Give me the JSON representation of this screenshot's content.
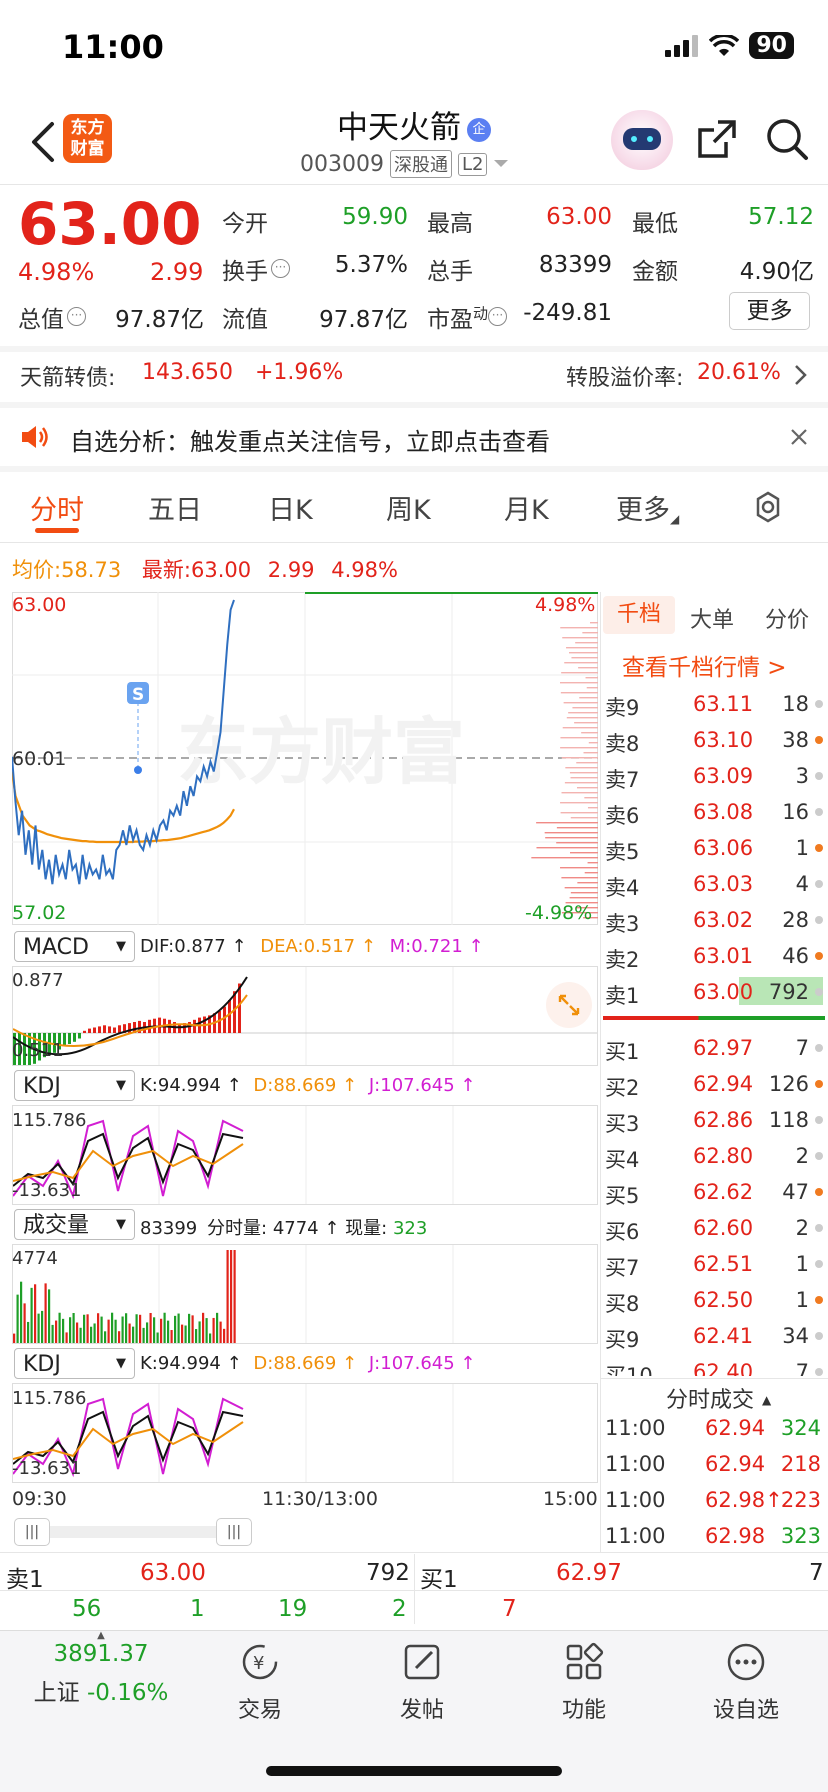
{
  "status_bar": {
    "time": "11:00",
    "battery": "90"
  },
  "header": {
    "name": "中天火箭",
    "badge": "企",
    "code": "003009",
    "tag1": "深股通",
    "tag2": "L2",
    "logo_line1": "东方",
    "logo_line2": "财富"
  },
  "quote": {
    "price": "63.00",
    "change_pct": "4.98%",
    "change": "2.99",
    "open_label": "今开",
    "open": "59.90",
    "high_label": "最高",
    "high": "63.00",
    "low_label": "最低",
    "low": "57.12",
    "turnover_label": "换手",
    "turnover": "5.37%",
    "volume_label": "总手",
    "volume": "83399",
    "amount_label": "金额",
    "amount": "4.90亿",
    "mktcap_label": "总值",
    "mktcap": "97.87亿",
    "float_label": "流值",
    "float": "97.87亿",
    "pe_label": "市盈",
    "pe_sup": "动",
    "pe": "-249.81",
    "more": "更多"
  },
  "bond": {
    "label": "天箭转债:",
    "price": "143.650",
    "change": "+1.96%",
    "premium_label": "转股溢价率:",
    "premium": "20.61%"
  },
  "notice": {
    "text": "自选分析：触发重点关注信号，立即点击查看"
  },
  "tabs": [
    "分时",
    "五日",
    "日K",
    "周K",
    "月K",
    "更多"
  ],
  "summary": {
    "avg_label": "均价:",
    "avg": "58.73",
    "last_label": "最新:",
    "last": "63.00",
    "chg": "2.99",
    "pct": "4.98%"
  },
  "chart_data": [
    {
      "type": "line",
      "x_start": "09:30",
      "x_mid": "11:30/13:00",
      "x_end": "15:00",
      "ylim": [
        57.02,
        63.0
      ],
      "y_top": "63.00",
      "y_mid": "60.01",
      "y_bottom": "57.02",
      "pct_top": "4.98%",
      "pct_bottom": "-4.98%",
      "watermark": "东方财富",
      "marker": "S",
      "series": [
        {
          "color": "#2f6fc0",
          "values": [
            59.8,
            58.9,
            58.2,
            58.7,
            57.8,
            58.3,
            57.6,
            58.4,
            57.5,
            57.9,
            57.3,
            57.7,
            57.2,
            57.8,
            57.4,
            57.6,
            57.3,
            57.9,
            57.5,
            57.6,
            57.2,
            57.8,
            57.3,
            57.6,
            57.4,
            57.5,
            57.3,
            57.8,
            57.4,
            57.5,
            57.3,
            57.9,
            58.0,
            58.3,
            58.0,
            58.4,
            58.1,
            58.3,
            58.0,
            57.9,
            58.2,
            58.0,
            58.3,
            58.1,
            58.4,
            58.5,
            58.3,
            58.7,
            58.6,
            58.8,
            58.6,
            59.1,
            58.8,
            59.2,
            59.0,
            59.4,
            59.3,
            59.6,
            59.4,
            59.7,
            59.5,
            59.9,
            60.3,
            61.2,
            62.1,
            62.8,
            63.0
          ]
        },
        {
          "color": "#f0900a",
          "values": [
            59.5,
            59.0,
            58.8,
            58.6,
            58.5,
            58.4,
            58.35,
            58.3,
            58.28,
            58.25,
            58.22,
            58.2,
            58.18,
            58.16,
            58.14,
            58.13,
            58.12,
            58.11,
            58.1,
            58.09,
            58.08,
            58.08,
            58.07,
            58.07,
            58.06,
            58.06,
            58.06,
            58.06,
            58.06,
            58.06,
            58.06,
            58.06,
            58.06,
            58.06,
            58.06,
            58.07,
            58.07,
            58.07,
            58.08,
            58.08,
            58.08,
            58.09,
            58.09,
            58.1,
            58.1,
            58.11,
            58.12,
            58.13,
            58.14,
            58.16,
            58.18,
            58.2,
            58.22,
            58.24,
            58.26,
            58.28,
            58.3,
            58.33,
            58.36,
            58.4,
            58.45,
            58.52,
            58.6,
            58.73
          ]
        }
      ]
    },
    {
      "type": "bar",
      "indicator": "MACD",
      "dif_label": "DIF:",
      "dif": "0.877",
      "dea_label": "DEA:",
      "dea": "0.517",
      "m_label": "M:",
      "m": "0.721",
      "y_top": "0.877",
      "y_bottom": "0.511",
      "histogram": [
        -0.3,
        -0.35,
        -0.32,
        -0.3,
        -0.28,
        -0.25,
        -0.22,
        -0.2,
        -0.18,
        -0.15,
        -0.12,
        -0.1,
        -0.08,
        -0.05,
        0.02,
        0.04,
        0.05,
        0.06,
        0.07,
        0.06,
        0.05,
        0.07,
        0.08,
        0.09,
        0.1,
        0.11,
        0.1,
        0.12,
        0.13,
        0.14,
        0.13,
        0.12,
        0.1,
        0.08,
        0.09,
        0.1,
        0.12,
        0.14,
        0.15,
        0.16,
        0.18,
        0.2,
        0.24,
        0.3,
        0.38,
        0.45
      ]
    },
    {
      "type": "line",
      "indicator": "KDJ",
      "k_label": "K:",
      "k": "94.994",
      "d_label": "D:",
      "d": "88.669",
      "j_label": "J:",
      "j": "107.645",
      "y_top": "115.786",
      "y_bottom": "-13.631"
    },
    {
      "type": "bar",
      "indicator": "成交量",
      "total": "83399",
      "tick_label": "分时量:",
      "tick": "4774",
      "now_label": "现量:",
      "now": "323",
      "y_top": "4774"
    },
    {
      "type": "line",
      "indicator": "KDJ",
      "k_label": "K:",
      "k": "94.994",
      "d_label": "D:",
      "d": "88.669",
      "j_label": "J:",
      "j": "107.645",
      "y_top": "115.786",
      "y_bottom": "-13.631"
    }
  ],
  "orderbook": {
    "tabs": [
      "千档",
      "大单",
      "分价"
    ],
    "link": "查看千档行情 >",
    "asks": [
      {
        "name": "卖9",
        "price": "63.11",
        "vol": "18"
      },
      {
        "name": "卖8",
        "price": "63.10",
        "vol": "38"
      },
      {
        "name": "卖7",
        "price": "63.09",
        "vol": "3"
      },
      {
        "name": "卖6",
        "price": "63.08",
        "vol": "16"
      },
      {
        "name": "卖5",
        "price": "63.06",
        "vol": "1"
      },
      {
        "name": "卖4",
        "price": "63.03",
        "vol": "4"
      },
      {
        "name": "卖3",
        "price": "63.02",
        "vol": "28"
      },
      {
        "name": "卖2",
        "price": "63.01",
        "vol": "46"
      },
      {
        "name": "卖1",
        "price": "63.00",
        "vol": "792"
      }
    ],
    "bids": [
      {
        "name": "买1",
        "price": "62.97",
        "vol": "7"
      },
      {
        "name": "买2",
        "price": "62.94",
        "vol": "126"
      },
      {
        "name": "买3",
        "price": "62.86",
        "vol": "118"
      },
      {
        "name": "买4",
        "price": "62.80",
        "vol": "2"
      },
      {
        "name": "买5",
        "price": "62.62",
        "vol": "47"
      },
      {
        "name": "买6",
        "price": "62.60",
        "vol": "2"
      },
      {
        "name": "买7",
        "price": "62.51",
        "vol": "1"
      },
      {
        "name": "买8",
        "price": "62.50",
        "vol": "1"
      },
      {
        "name": "买9",
        "price": "62.41",
        "vol": "34"
      },
      {
        "name": "买10",
        "price": "62.40",
        "vol": "7"
      }
    ],
    "ticks_title": "分时成交",
    "ticks": [
      {
        "time": "11:00",
        "price": "62.94",
        "vol": "324",
        "color": "#1e9f27"
      },
      {
        "time": "11:00",
        "price": "62.94",
        "vol": "218",
        "color": "#e2231a"
      },
      {
        "time": "11:00",
        "price": "62.98↑",
        "vol": "223",
        "color": "#e2231a"
      },
      {
        "time": "11:00",
        "price": "62.98",
        "vol": "323",
        "color": "#1e9f27"
      }
    ]
  },
  "bottom_quote": {
    "ask_label": "卖1",
    "ask_price": "63.00",
    "ask_vol": "792",
    "bid_label": "买1",
    "bid_price": "62.97",
    "bid_vol": "7",
    "n1": "56",
    "n2": "1",
    "n3": "19",
    "n4": "2",
    "n5": "7"
  },
  "nav": {
    "index_value": "3891.37",
    "index_name": "上证",
    "index_change": "-0.16%",
    "trade": "交易",
    "post": "发帖",
    "func": "功能",
    "watch": "设自选"
  }
}
